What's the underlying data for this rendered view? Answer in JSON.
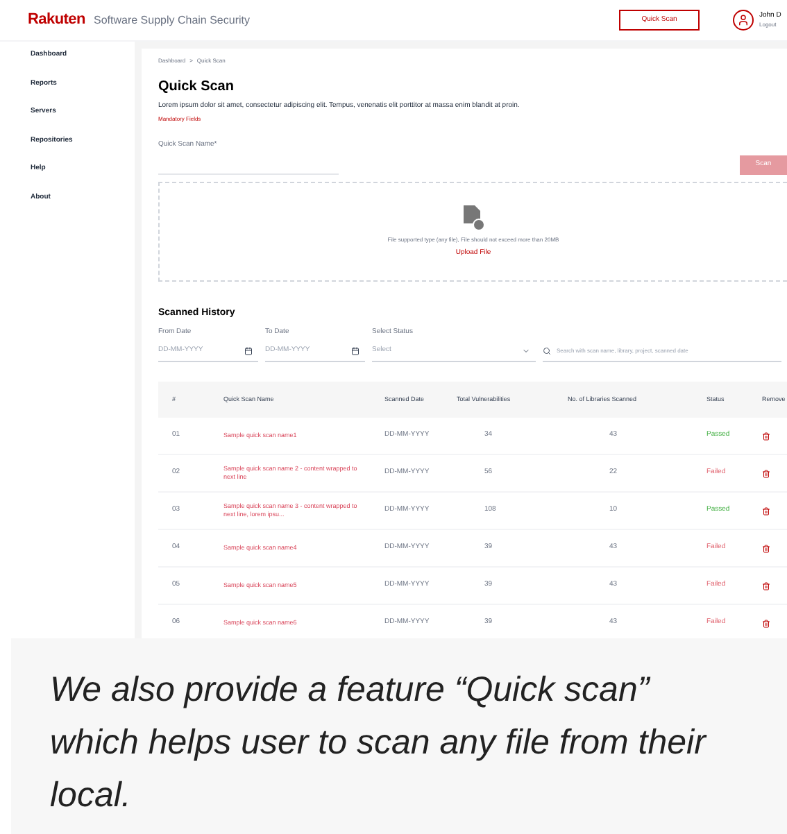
{
  "header": {
    "logo": "Rakuten",
    "app_title": "Software Supply Chain Security",
    "quick_scan_button": "Quick Scan",
    "user": {
      "name": "John D",
      "logout": "Logout"
    }
  },
  "sidebar": {
    "items": [
      {
        "label": "Dashboard"
      },
      {
        "label": "Reports"
      },
      {
        "label": "Servers"
      },
      {
        "label": "Repositories"
      },
      {
        "label": "Help"
      },
      {
        "label": "About"
      }
    ]
  },
  "breadcrumb": [
    "Dashboard",
    ">",
    "Quick Scan"
  ],
  "page": {
    "title": "Quick Scan",
    "description": "Lorem ipsum dolor sit amet, consectetur adipiscing elit. Tempus, venenatis elit porttitor at massa enim blandit at proin.",
    "mandatory_note": "Mandatory Fields"
  },
  "scan_form": {
    "label": "Quick Scan Name*",
    "scan_button": "Scan",
    "disabled": true
  },
  "upload": {
    "hint": "File supported type (any file), File should not exceed more than 20MB",
    "link": "Upload File"
  },
  "history": {
    "title": "Scanned History",
    "filters": [
      {
        "kind": "date",
        "label": "From Date",
        "placeholder": "DD-MM-YYYY"
      },
      {
        "kind": "date",
        "label": "To Date",
        "placeholder": "DD-MM-YYYY"
      },
      {
        "kind": "select",
        "label": "Select Status",
        "placeholder": "Select"
      },
      {
        "kind": "search",
        "placeholder": "Search with scan name, library, project, scanned date"
      }
    ],
    "columns": [
      "#",
      "Quick Scan Name",
      "Scanned Date",
      "Total Vulnerabilities",
      "No. of Libraries Scanned",
      "Status",
      "Remove"
    ],
    "rows": [
      {
        "no": "01",
        "name": "Sample quick scan name1",
        "date": "DD-MM-YYYY",
        "total": "34",
        "libraries": "43",
        "status": "Passed",
        "kind": "passed"
      },
      {
        "no": "02",
        "name": "Sample quick scan name 2 - content wrapped to next line",
        "date": "DD-MM-YYYY",
        "total": "56",
        "libraries": "22",
        "status": "Failed",
        "kind": "failed"
      },
      {
        "no": "03",
        "name": "Sample quick scan name 3 - content wrapped to next line, lorem ipsu...",
        "date": "DD-MM-YYYY",
        "total": "108",
        "libraries": "10",
        "status": "Passed",
        "kind": "passed"
      },
      {
        "no": "04",
        "name": "Sample quick scan name4",
        "date": "DD-MM-YYYY",
        "total": "39",
        "libraries": "43",
        "status": "Failed",
        "kind": "failed"
      },
      {
        "no": "05",
        "name": "Sample quick scan name5",
        "date": "DD-MM-YYYY",
        "total": "39",
        "libraries": "43",
        "status": "Failed",
        "kind": "failed"
      },
      {
        "no": "06",
        "name": "Sample quick scan name6",
        "date": "DD-MM-YYYY",
        "total": "39",
        "libraries": "43",
        "status": "Failed",
        "kind": "failed"
      }
    ]
  },
  "caption": "We also provide a feature “Quick scan” which helps user to scan any file from their local."
}
